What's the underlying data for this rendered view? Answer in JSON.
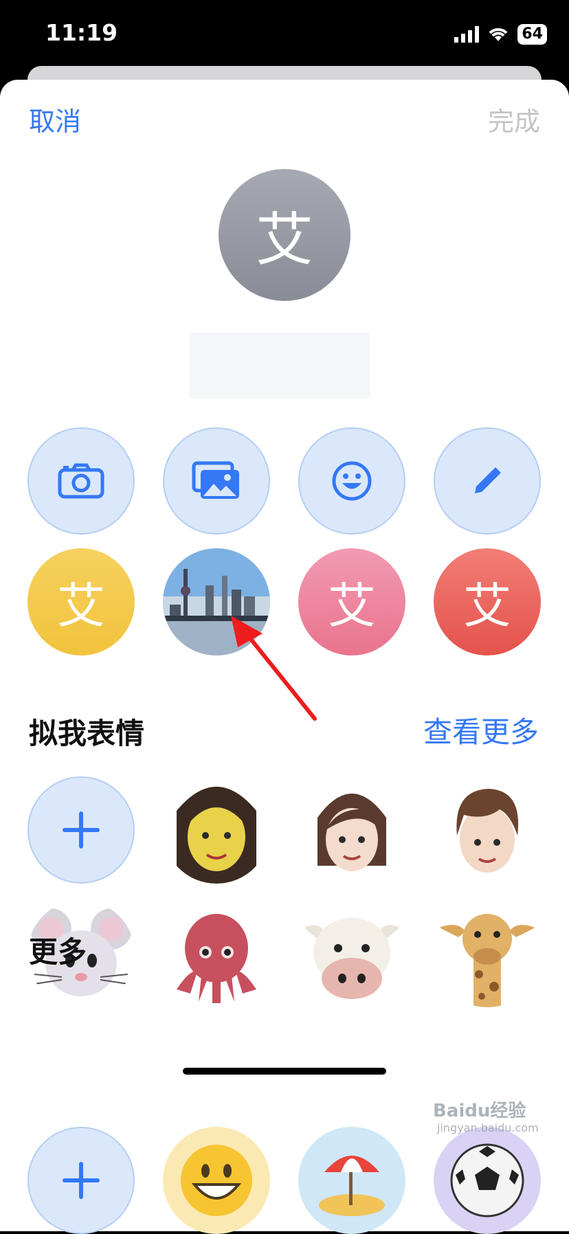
{
  "status_bar": {
    "time": "11:19",
    "battery": "64"
  },
  "nav": {
    "cancel": "取消",
    "done": "完成"
  },
  "avatar": {
    "initial": "艾"
  },
  "memoji": {
    "title": "拟我表情",
    "see_more": "查看更多"
  },
  "more": {
    "title": "更多"
  },
  "watermark": {
    "text": "Baidu经验",
    "sub": "jingyan.baidu.com"
  },
  "colors": {
    "accent": "#3478f6",
    "light_button": "#dbe8fb"
  },
  "icons": [
    "camera-icon",
    "photos-icon",
    "emoji-icon",
    "pencil-icon",
    "plus-icon",
    "smiley-icon",
    "beach-umbrella-icon",
    "soccer-ball-icon"
  ]
}
